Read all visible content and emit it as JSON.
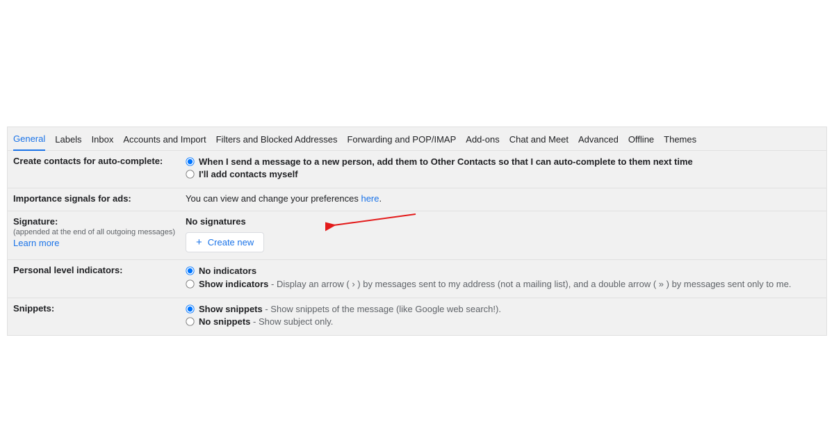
{
  "tabs": [
    "General",
    "Labels",
    "Inbox",
    "Accounts and Import",
    "Filters and Blocked Addresses",
    "Forwarding and POP/IMAP",
    "Add-ons",
    "Chat and Meet",
    "Advanced",
    "Offline",
    "Themes"
  ],
  "active_tab": 0,
  "contacts": {
    "title": "Create contacts for auto-complete:",
    "opt1": "When I send a message to a new person, add them to Other Contacts so that I can auto-complete to them next time",
    "opt2": "I'll add contacts myself"
  },
  "ads": {
    "title": "Importance signals for ads:",
    "text_pre": "You can view and change your preferences ",
    "link": "here",
    "text_post": "."
  },
  "signature": {
    "title": "Signature:",
    "sub": "(appended at the end of all outgoing messages)",
    "learn": "Learn more",
    "none": "No signatures",
    "create": "Create new"
  },
  "pli": {
    "title": "Personal level indicators:",
    "opt1": "No indicators",
    "opt2_label": "Show indicators",
    "opt2_desc": " - Display an arrow ( › ) by messages sent to my address (not a mailing list), and a double arrow ( » ) by messages sent only to me."
  },
  "snippets": {
    "title": "Snippets:",
    "opt1_label": "Show snippets",
    "opt1_desc": " - Show snippets of the message (like Google web search!).",
    "opt2_label": "No snippets",
    "opt2_desc": " - Show subject only."
  }
}
